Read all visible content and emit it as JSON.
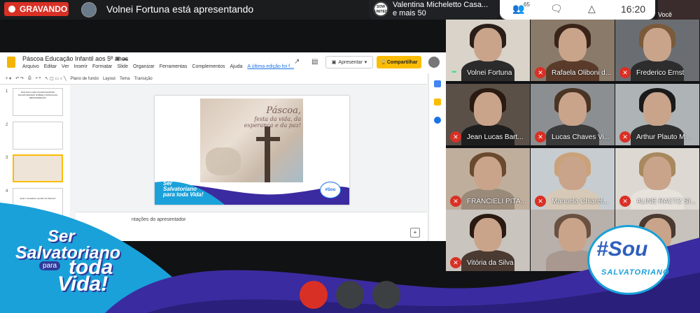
{
  "topbar": {
    "recording_label": "GRAVANDO",
    "presenter_text": "Volnei Fortuna está apresentando",
    "participant_pill": {
      "name": "Valentina Micheletto Casa...",
      "more": "e mais 50",
      "badge": "SOW UNITED"
    },
    "people_count": "65",
    "time": "16:20",
    "self_label": "Você"
  },
  "slides": {
    "doc_title": "Páscoa Educação Infantil aos 5º anos",
    "menu": [
      "Arquivo",
      "Editar",
      "Ver",
      "Inserir",
      "Formatar",
      "Slide",
      "Organizar",
      "Ferramentas",
      "Complementos",
      "Ajuda"
    ],
    "last_edit": "A última edição foi f...",
    "present_label": "Apresentar",
    "share_label": "Compartilhar",
    "toolbar": [
      "Plano de fundo",
      "Layout",
      "Tema",
      "Transição"
    ],
    "thumb_numbers": [
      "1",
      "2",
      "3",
      "4"
    ],
    "thumb_texts": [
      "DIÁLOGO COM OS ESTUDANTES SALVATORIANOS SOBRE A PÁSCOA DA RESSURREIÇÃO",
      "",
      "",
      "Qual o verdadeiro sentido da Páscoa?"
    ],
    "slide_script_1": "Páscoa,",
    "slide_script_2": "festa da vida, da esperança e da paz!",
    "slide_brand": "Ser Salvatoriano para toda Vida!",
    "slide_sou": "#Sou",
    "notes": "ntações do apresentador"
  },
  "tiles": [
    {
      "name": "Volnei Fortuna",
      "muted": false,
      "bg": "#d9d3c9",
      "shirt": "#2b2b2b",
      "hair": "#2a1f18"
    },
    {
      "name": "Rafaela Oliboni d...",
      "muted": true,
      "bg": "#8a7a6a",
      "shirt": "#5a3b2a",
      "hair": "#3a2418"
    },
    {
      "name": "Frederico Ernst",
      "muted": true,
      "bg": "#6a6e72",
      "shirt": "#2d2d2d",
      "hair": "#7a5a3a"
    },
    {
      "name": "Jean Lucas Bart...",
      "muted": true,
      "bg": "#5a5048",
      "shirt": "#1e1e1e",
      "hair": "#2a1a12"
    },
    {
      "name": "Lucas Chaves Vi...",
      "muted": true,
      "bg": "#8c8f92",
      "shirt": "#3a3a3a",
      "hair": "#4a3424"
    },
    {
      "name": "Arthur Plauto M...",
      "muted": true,
      "bg": "#aeb3b6",
      "shirt": "#2f2f2f",
      "hair": "#1a1a1a"
    },
    {
      "name": "FRANCIELI PITA...",
      "muted": true,
      "bg": "#bfae9c",
      "shirt": "#9a8a7a",
      "hair": "#6a4a2e"
    },
    {
      "name": "Manuela Chiarel...",
      "muted": true,
      "bg": "#c7ccd0",
      "shirt": "#d7c9b7",
      "hair": "#caa27a"
    },
    {
      "name": "ALINE RACTZ SI...",
      "muted": true,
      "bg": "#ddd8d2",
      "shirt": "#e7e2dc",
      "hair": "#a8885e"
    },
    {
      "name": "Vitória da Silva",
      "muted": true,
      "bg": "#c9c4be",
      "shirt": "#4a3a32",
      "hair": "#2a1a12"
    },
    {
      "name": "",
      "muted": false,
      "bg": "#b8b0aa",
      "shirt": "#a89890",
      "hair": "#6a5040"
    },
    {
      "name": "",
      "muted": false,
      "bg": "#c8c2bd",
      "shirt": "#9a8a80",
      "hair": "#4a3a30"
    }
  ],
  "brand": {
    "line1": "Ser",
    "line2": "Salvatoriano",
    "line3": "para",
    "line4": "toda",
    "line5": "Vida!"
  },
  "sou_badge": {
    "line1": "#Sou",
    "line2": "SALVATORIANO"
  },
  "colors": {
    "record_red": "#d93025",
    "purple": "#3b2ba0",
    "cyan": "#1aa1d9",
    "accent_yellow": "#fbbc04"
  }
}
